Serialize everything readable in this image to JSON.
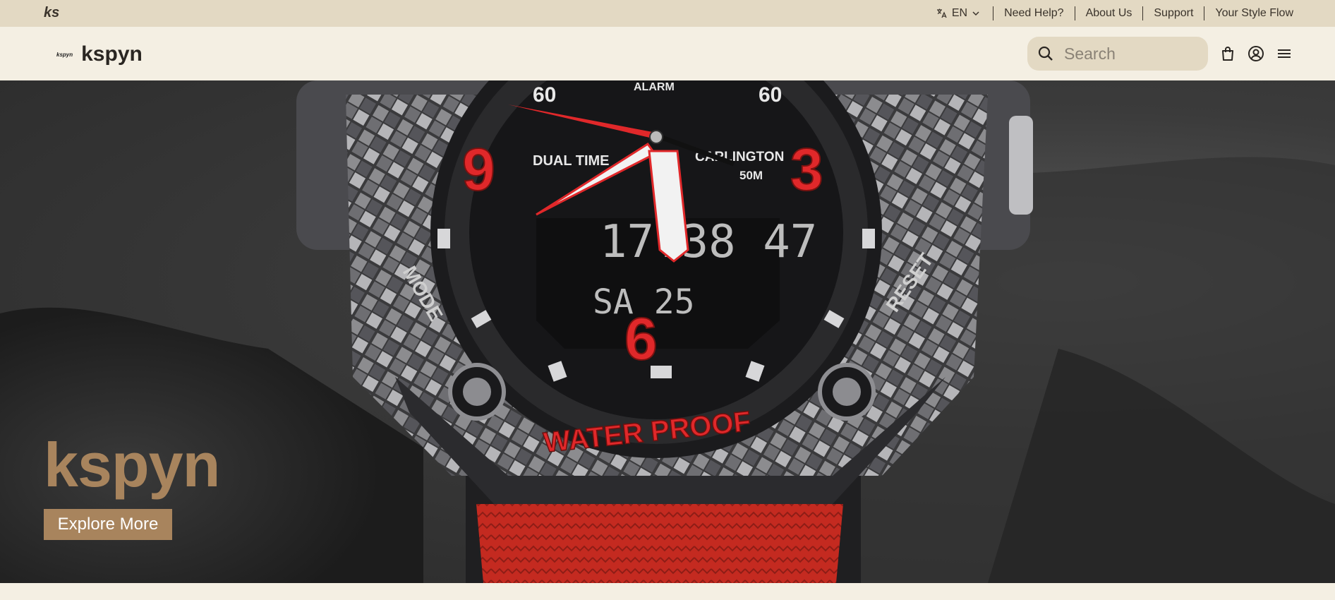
{
  "topbar": {
    "brand_mark": "ks",
    "language": "EN",
    "links": [
      "Need Help?",
      "About Us",
      "Support",
      "Your Style Flow"
    ]
  },
  "header": {
    "logo_small": "kspyn",
    "logo_name": "kspyn",
    "search_placeholder": "Search"
  },
  "hero": {
    "title": "kspyn",
    "button_label": "Explore More",
    "watch_text": {
      "alarm": "ALARM",
      "dual_time": "DUAL TIME",
      "brand": "CARLINGTON",
      "depth": "50M",
      "waterproof": "WATER PROOF",
      "digital_time": "17:38 47",
      "digital_date": "SA 25",
      "num_9": "9",
      "num_3": "3",
      "num_6": "6",
      "num_60_left": "60",
      "num_60_right": "60",
      "mode": "MODE",
      "reset": "RESET"
    }
  },
  "icons": [
    "translate-icon",
    "chevron-down-icon",
    "search-icon",
    "bag-icon",
    "account-icon",
    "menu-icon"
  ],
  "colors": {
    "topbar_bg": "#e3d9c3",
    "page_bg": "#f4efe3",
    "accent": "#a8845d",
    "watch_red": "#e0282a"
  }
}
